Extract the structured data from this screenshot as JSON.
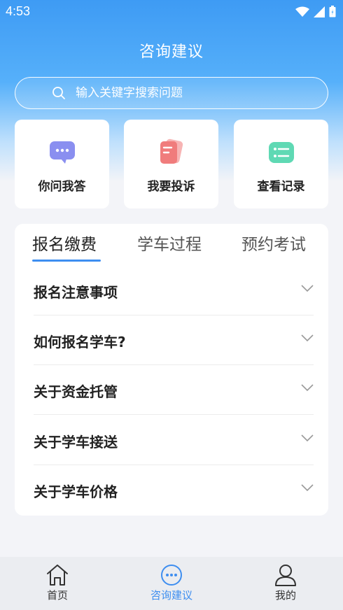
{
  "status_bar": {
    "time": "4:53"
  },
  "page": {
    "title": "咨询建议"
  },
  "search": {
    "placeholder": "输入关键字搜索问题"
  },
  "quick_actions": [
    {
      "label": "你问我答",
      "icon": "chat-bubble-icon"
    },
    {
      "label": "我要投诉",
      "icon": "complaint-document-icon"
    },
    {
      "label": "查看记录",
      "icon": "record-list-icon"
    }
  ],
  "tabs": [
    {
      "label": "报名缴费",
      "active": true
    },
    {
      "label": "学车过程",
      "active": false
    },
    {
      "label": "预约考试",
      "active": false
    }
  ],
  "faq": [
    {
      "label": "报名注意事项"
    },
    {
      "label": "如何报名学车?"
    },
    {
      "label": "关于资金托管"
    },
    {
      "label": "关于学车接送"
    },
    {
      "label": "关于学车价格"
    }
  ],
  "tabbar": [
    {
      "label": "首页",
      "icon": "home-icon",
      "active": false
    },
    {
      "label": "咨询建议",
      "icon": "more-circle-icon",
      "active": true
    },
    {
      "label": "我的",
      "icon": "person-icon",
      "active": false
    }
  ],
  "colors": {
    "accent": "#3e8ef0",
    "header_top": "#3e9bf4",
    "background": "#f3f4f8"
  }
}
